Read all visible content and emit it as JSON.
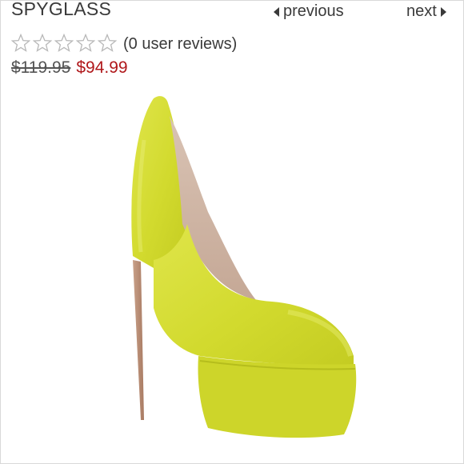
{
  "product": {
    "title": "SPYGLASS",
    "rating": 0,
    "rating_max": 5,
    "reviews_label": "(0 user reviews)",
    "original_price": "$119.95",
    "sale_price": "$94.99",
    "image_icon": "yellow-platform-pump"
  },
  "nav": {
    "previous_label": "previous",
    "next_label": "next"
  },
  "colors": {
    "sale_price": "#b0181b",
    "shoe": "#d4dc32",
    "star_outline": "#b8b8b8"
  }
}
